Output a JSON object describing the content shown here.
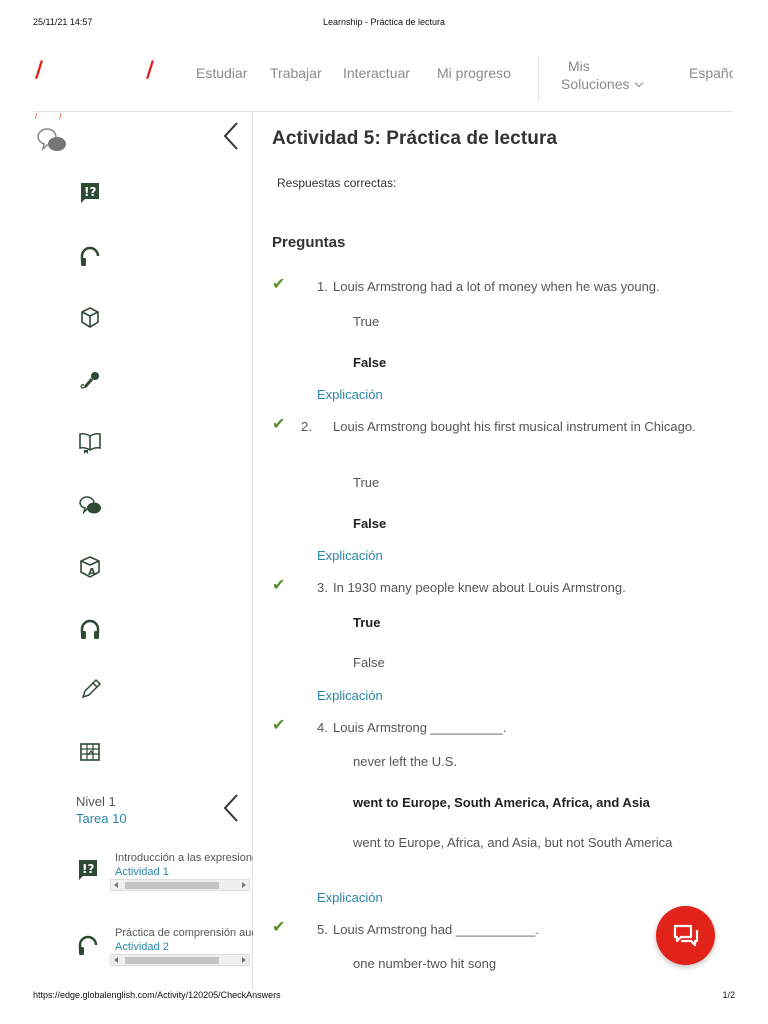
{
  "print": {
    "datetime": "25/11/21 14:57",
    "title": "Learnship - Práctica de lectura",
    "url": "https://edge.globalenglish.com/Activity/120205/CheckAnswers",
    "page": "1/2"
  },
  "nav": {
    "slash": "/",
    "links": [
      "Estudiar",
      "Trabajar",
      "Interactuar",
      "Mi progreso"
    ],
    "mis_line1": "Mis",
    "mis_line2": "Soluciones",
    "language": "Españo"
  },
  "sidebar": {
    "tiny_marks": [
      "/",
      "/"
    ],
    "icons": [
      "speech-bubbles-icon",
      "question-flag-icon",
      "headphone-single-icon",
      "cube-icon",
      "microphone-icon",
      "open-book-icon",
      "speech-bubbles-small-icon",
      "letter-cube-icon",
      "headphones-icon",
      "pencil-icon",
      "grid-table-icon"
    ],
    "level": "Nivel 1",
    "task": "Tarea 10",
    "activities": [
      {
        "title": "Introducción a las expresiones",
        "sub": "Actividad 1",
        "icon": "question-flag-icon"
      },
      {
        "title": "Práctica de comprensión auditiva",
        "sub": "Actividad 2",
        "icon": "headphone-single-icon"
      }
    ]
  },
  "main": {
    "title": "Actividad 5: Práctica de lectura",
    "correct_label": "Respuestas correctas:",
    "questions_heading": "Preguntas",
    "explanation_label": "Explicación",
    "check_glyph": "✔",
    "questions": [
      {
        "num": "1.",
        "text": "Louis Armstrong had a lot of money when he was young.",
        "options": [
          "True",
          "False"
        ],
        "selected": 1
      },
      {
        "num": "2.",
        "text": "Louis Armstrong bought his first musical instrument in Chicago.",
        "options": [
          "True",
          "False"
        ],
        "selected": 1
      },
      {
        "num": "3.",
        "text": "In 1930 many people knew about Louis Armstrong.",
        "options": [
          "True",
          "False"
        ],
        "selected": 0
      },
      {
        "num": "4.",
        "text": "Louis Armstrong __________.",
        "options": [
          "never left the U.S.",
          "went to Europe, South America, Africa, and Asia",
          "went to Europe, Africa, and Asia, but not South America"
        ],
        "selected": 1
      },
      {
        "num": "5.",
        "text": "Louis Armstrong had ___________.",
        "options": [
          "one number-two hit song"
        ],
        "selected": -1
      }
    ]
  },
  "colors": {
    "accent_red": "#e2231a",
    "link_blue": "#2a86a8",
    "check_green": "#5a8f2a",
    "icon_dark": "#2f4a33"
  }
}
